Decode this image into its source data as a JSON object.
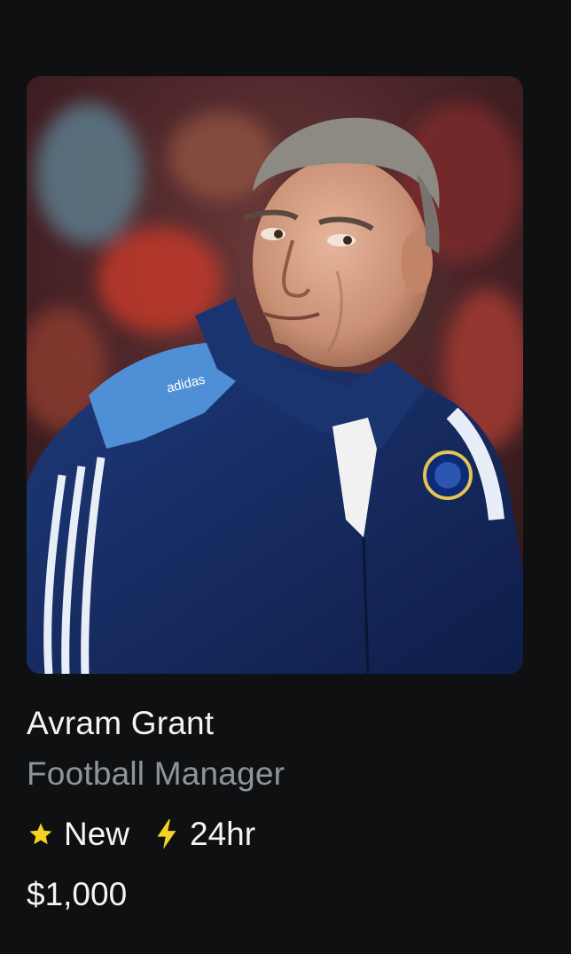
{
  "listing": {
    "name": "Avram Grant",
    "role": "Football Manager",
    "badges": [
      {
        "icon": "star-icon",
        "label": "New",
        "color": "#f5d324"
      },
      {
        "icon": "lightning-bolt-icon",
        "label": "24hr",
        "color": "#f5d324"
      }
    ],
    "price": "$1,000",
    "photo_jacket_logo": "adidas"
  },
  "colors": {
    "background": "#0f1012",
    "name_text": "#f4f4f4",
    "role_text": "#8f949b",
    "accent_yellow": "#f5d324"
  }
}
